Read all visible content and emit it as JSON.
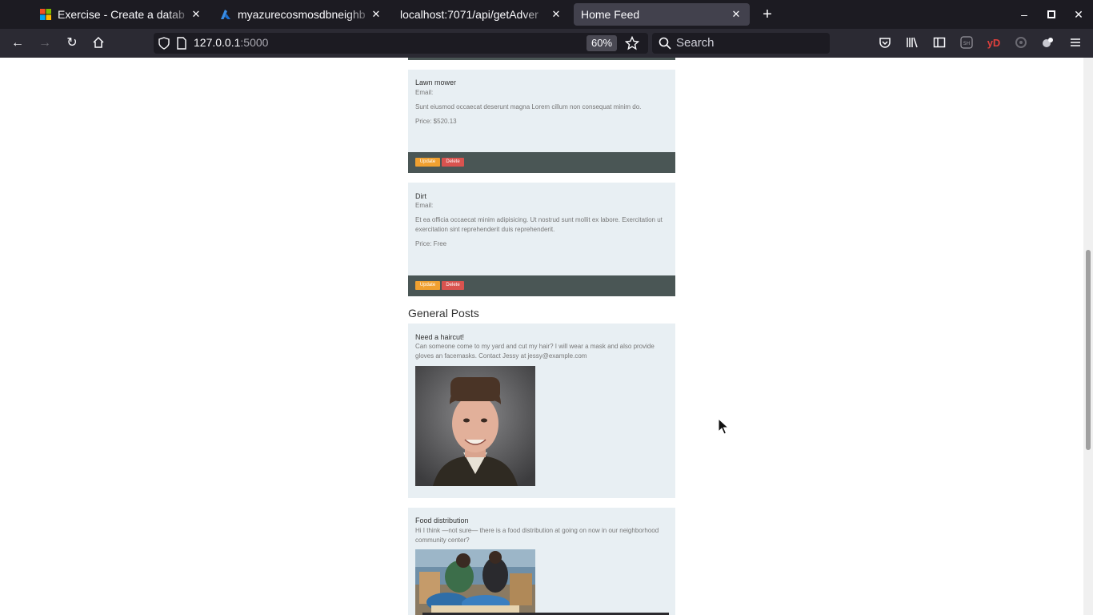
{
  "browser": {
    "tabs": [
      {
        "title": "Exercise - Create a datab",
        "icon": "microsoft-logo-icon"
      },
      {
        "title": "myazurecosmosdbneighb",
        "icon": "azure-logo-icon"
      },
      {
        "title": "localhost:7071/api/getAdver",
        "icon": ""
      },
      {
        "title": "Home Feed",
        "icon": ""
      }
    ],
    "url_host": "127.0.0.1",
    "url_port": ":5000",
    "zoom": "60%",
    "search_placeholder": "Search"
  },
  "posts": [
    {
      "title": "Lawn mower",
      "email_label": "Email:",
      "description": "Sunt eiusmod occaecat deserunt magna Lorem cillum non consequat minim do.",
      "price": "Price: $520.13",
      "update_label": "Update",
      "delete_label": "Delete"
    },
    {
      "title": "Dirt",
      "email_label": "Email:",
      "description": "Et ea officia occaecat minim adipisicing. Ut nostrud sunt mollit ex labore. Exercitation ut exercitation sint reprehenderit duis reprehenderit.",
      "price": "Price: Free",
      "update_label": "Update",
      "delete_label": "Delete"
    }
  ],
  "general_heading": "General Posts",
  "general_posts": [
    {
      "title": "Need a haircut!",
      "body": "Can someone come to my yard and cut my hair? I will wear a mask and also provide gloves an facemasks. Contact Jessy at jessy@example.com"
    },
    {
      "title": "Food distribution",
      "body": "Hi I think —not sure— there is a food distribution at going on now in our neighborhood community center?"
    }
  ],
  "colors": {
    "card_bg": "#e8eff3",
    "action_bar": "#4a5655",
    "update_btn": "#f0a030",
    "delete_btn": "#d9534f"
  }
}
